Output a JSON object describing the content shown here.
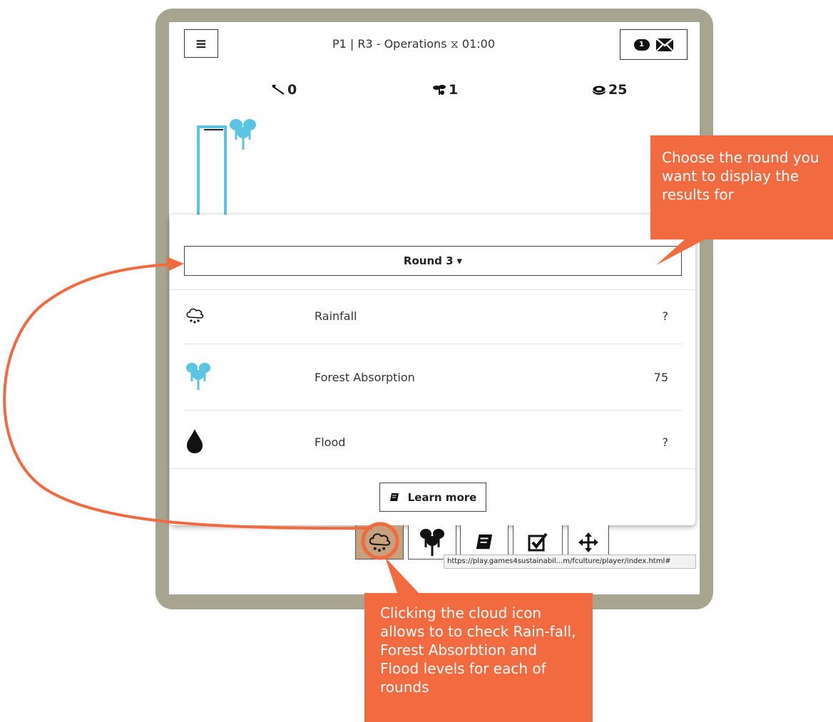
{
  "header": {
    "menu_icon": "hamburger-icon",
    "title": "P1 | R3 - Operations ⧖ 01:00",
    "message_count": "1",
    "mail_icon": "envelope-icon"
  },
  "stats": {
    "axe": {
      "icon": "axe-icon",
      "value": "0"
    },
    "seedling": {
      "icon": "seedling-icon",
      "value": "1"
    },
    "coins": {
      "icon": "coins-icon",
      "value": "25"
    }
  },
  "results_panel": {
    "round_selector": {
      "label": "Round 3",
      "caret": "▾"
    },
    "rows": [
      {
        "icon": "rain-cloud-icon",
        "label": "Rainfall",
        "value": "?"
      },
      {
        "icon": "trees-icon",
        "label": "Forest Absorption",
        "value": "75"
      },
      {
        "icon": "water-drop-icon",
        "label": "Flood",
        "value": "?"
      }
    ],
    "learn_more": {
      "icon": "book-icon",
      "label": "Learn more"
    }
  },
  "toolbar": [
    {
      "icon": "rain-cloud-icon",
      "active": true
    },
    {
      "icon": "trees-icon",
      "active": false
    },
    {
      "icon": "book-icon",
      "active": false
    },
    {
      "icon": "checkbox-icon",
      "active": false
    },
    {
      "icon": "move-arrows-icon",
      "active": false
    }
  ],
  "url_tooltip": "https://play.games4sustainabil...m/fculture/player/index.html#",
  "callouts": {
    "round": "Choose the round you want to display the results for",
    "cloud": "Clicking the cloud icon allows to to check Rain-fall, Forest Absorbtion and Flood levels for each of rounds"
  },
  "colors": {
    "frame": "#a7a58f",
    "callout": "#f26a40",
    "forest": "#5bc4e3",
    "active_tab": "#c7a07e"
  }
}
